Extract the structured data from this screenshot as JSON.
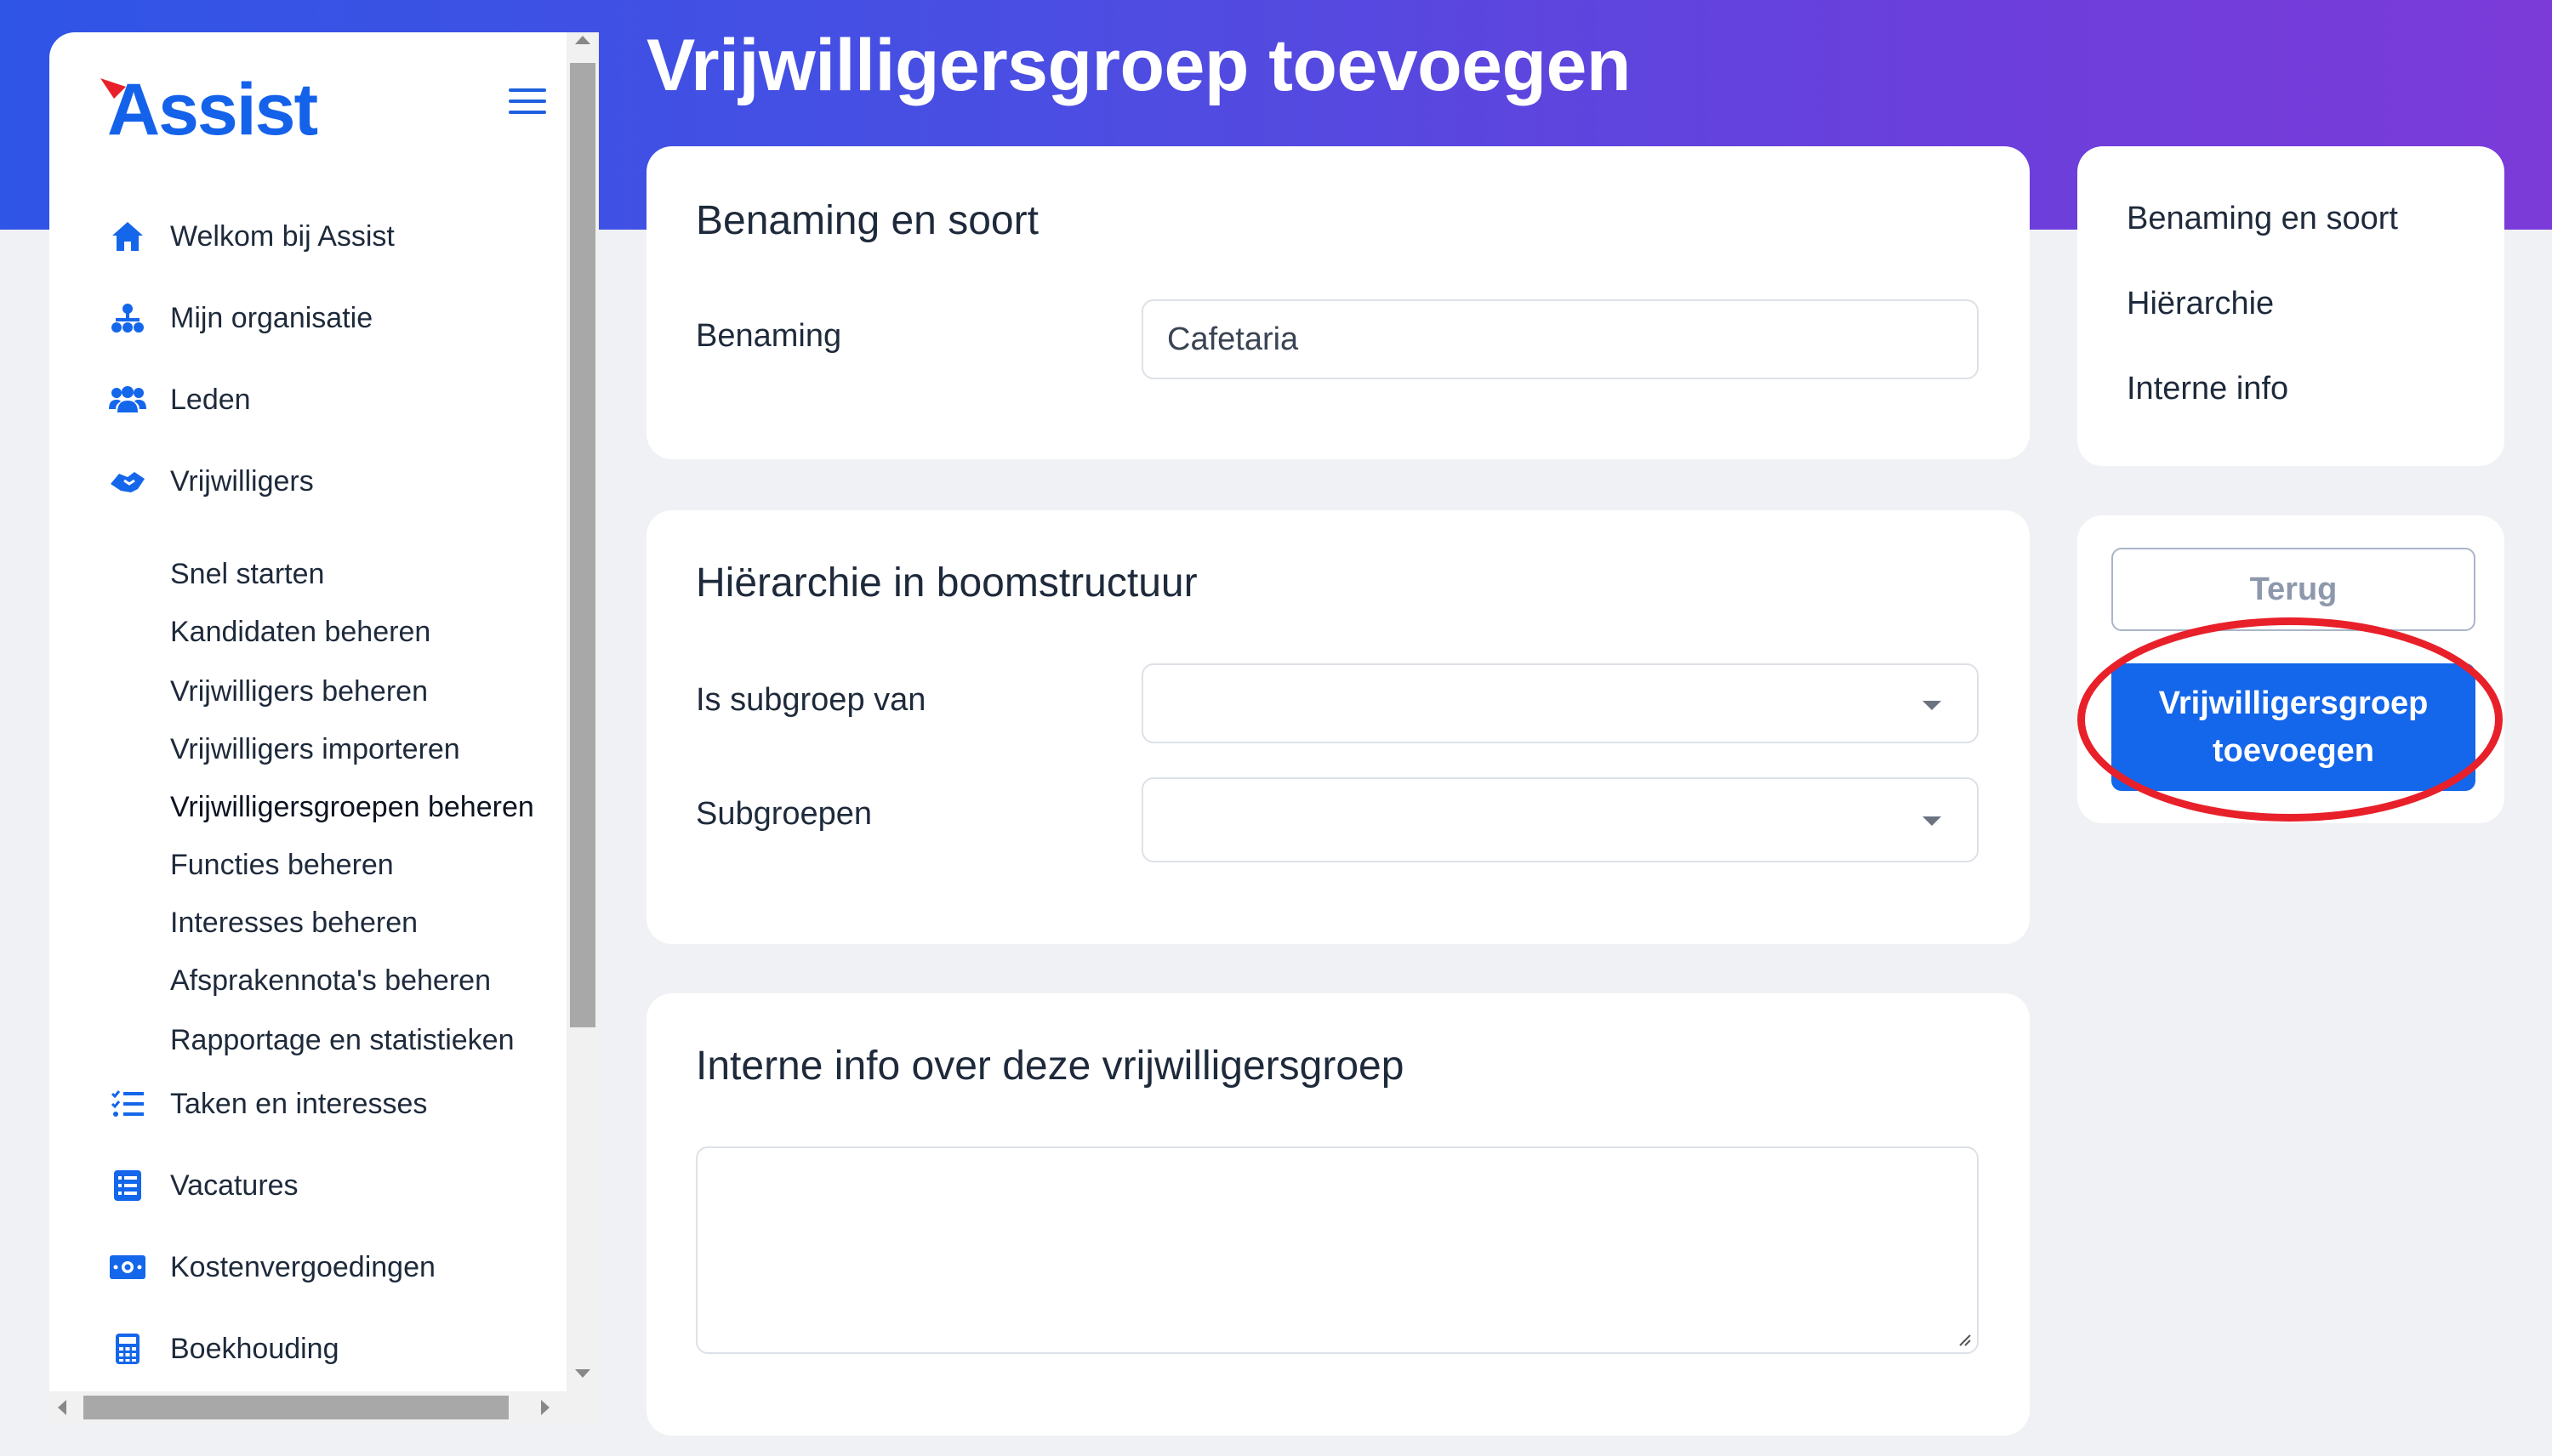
{
  "header": {
    "title": "Vrijwilligersgroep toevoegen"
  },
  "sidebar": {
    "logo_text": "Assist",
    "items": [
      {
        "label": "Welkom bij Assist",
        "icon": "home-icon"
      },
      {
        "label": "Mijn organisatie",
        "icon": "org-chart-icon"
      },
      {
        "label": "Leden",
        "icon": "users-icon",
        "expandable": true
      },
      {
        "label": "Vrijwilligers",
        "icon": "handshake-icon",
        "expanded": true
      },
      {
        "label": "Taken en interesses",
        "icon": "tasks-icon",
        "expandable": true
      },
      {
        "label": "Vacatures",
        "icon": "list-icon",
        "expandable": true
      },
      {
        "label": "Kostenvergoedingen",
        "icon": "money-icon",
        "expandable": true
      },
      {
        "label": "Boekhouding",
        "icon": "calculator-icon",
        "expandable": true
      }
    ],
    "subitems": [
      "Snel starten",
      "Kandidaten beheren",
      "Vrijwilligers beheren",
      "Vrijwilligers importeren",
      "Vrijwilligersgroepen beheren",
      "Functies beheren",
      "Interesses beheren",
      "Afsprakennota's beheren",
      "Rapportage en statistieken"
    ]
  },
  "form": {
    "section1": {
      "title": "Benaming en soort",
      "label": "Benaming",
      "value": "Cafetaria"
    },
    "section2": {
      "title": "Hiërarchie in boomstructuur",
      "parent_label": "Is subgroep van",
      "parent_value": "",
      "children_label": "Subgroepen",
      "children_value": ""
    },
    "section3": {
      "title": "Interne info over deze vrijwilligersgroep",
      "value": ""
    }
  },
  "toc": {
    "items": [
      "Benaming en soort",
      "Hiërarchie",
      "Interne info"
    ]
  },
  "actions": {
    "back_label": "Terug",
    "submit_label": "Vrijwilligersgroep toevoegen"
  },
  "colors": {
    "brand_blue": "#1466ea",
    "highlight_red": "#e8202a",
    "header_gradient_start": "#2f55e6",
    "header_gradient_end": "#7b3bd9"
  }
}
